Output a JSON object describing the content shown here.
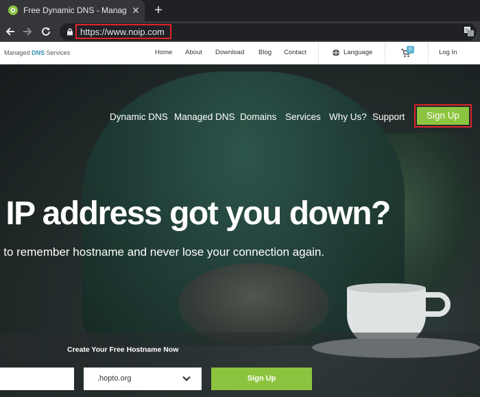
{
  "browser": {
    "tab_title": "Free Dynamic DNS - Managed",
    "url": "https://www.noip.com",
    "close_glyph": "✕",
    "new_tab_glyph": "+"
  },
  "site_topbar": {
    "brand_prefix": "Managed",
    "brand_highlight": "DNS",
    "brand_suffix": "Services",
    "links": [
      "Home",
      "About",
      "Download",
      "Blog",
      "Contact"
    ],
    "language": "Language",
    "cart_count": "0",
    "login": "Log In"
  },
  "hero": {
    "nav": [
      "Dynamic DNS",
      "Managed DNS",
      "Domains",
      "Services",
      "Why Us?",
      "Support"
    ],
    "signup": "Sign Up",
    "headline": "t IP address got you down?",
    "subline": "y to remember hostname and never lose your connection again."
  },
  "form": {
    "label": "Create Your Free Hostname Now",
    "domain_selected": ".hopto.org",
    "submit": "Sign Up"
  },
  "colors": {
    "accent_green": "#8cc43f",
    "highlight_red": "#e0242b",
    "brand_blue": "#2d8fae"
  }
}
